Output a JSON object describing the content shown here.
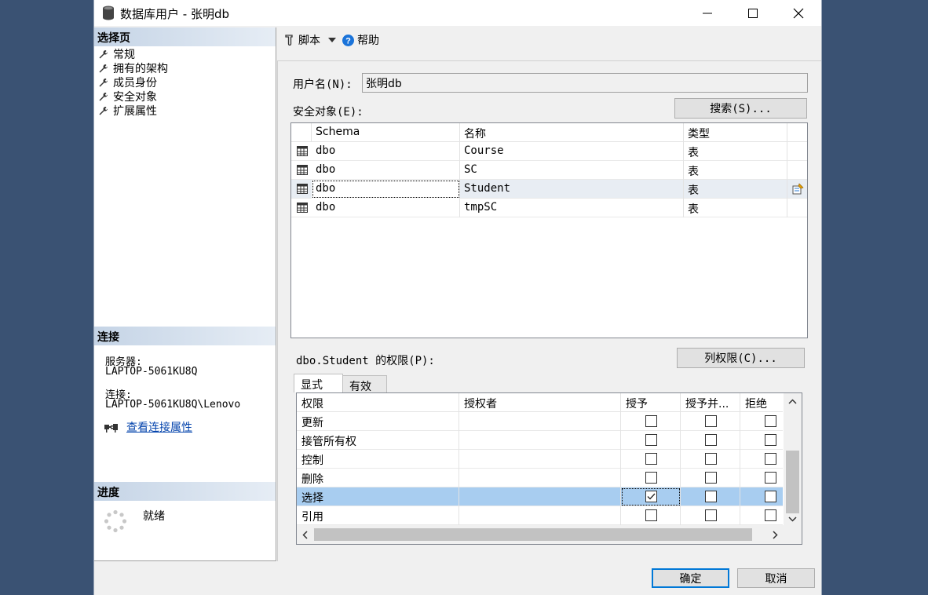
{
  "window": {
    "title": "数据库用户 - 张明db"
  },
  "left": {
    "select_page_header": "选择页",
    "pages": [
      {
        "label": "常规",
        "icon": "wrench-icon"
      },
      {
        "label": "拥有的架构",
        "icon": "wrench-icon"
      },
      {
        "label": "成员身份",
        "icon": "wrench-icon"
      },
      {
        "label": "安全对象",
        "icon": "wrench-icon"
      },
      {
        "label": "扩展属性",
        "icon": "wrench-icon"
      }
    ],
    "connection_header": "连接",
    "server_label": "服务器:",
    "server_value": "LAPTOP-5061KU8Q",
    "connection_label": "连接:",
    "connection_value": "LAPTOP-5061KU8Q\\Lenovo",
    "view_props_link": "查看连接属性",
    "progress_header": "进度",
    "progress_status": "就绪"
  },
  "toolbar": {
    "script_label": "脚本",
    "help_label": "帮助"
  },
  "form": {
    "username_label": "用户名(N):",
    "username_value": "张明db",
    "securables_label": "安全对象(E):",
    "search_button": "搜索(S)...",
    "permissions_label": "dbo.Student 的权限(P):",
    "column_perms_button": "列权限(C)..."
  },
  "securables": {
    "columns": [
      "Schema",
      "名称",
      "类型"
    ],
    "rows": [
      {
        "schema": "dbo",
        "name": "Course",
        "type": "表"
      },
      {
        "schema": "dbo",
        "name": "SC",
        "type": "表"
      },
      {
        "schema": "dbo",
        "name": "Student",
        "type": "表"
      },
      {
        "schema": "dbo",
        "name": "tmpSC",
        "type": "表"
      }
    ],
    "selected_row": 2
  },
  "tabs": {
    "explicit": "显式",
    "effective": "有效"
  },
  "permissions": {
    "columns": [
      "权限",
      "授权者",
      "授予",
      "授予并...",
      "拒绝"
    ],
    "rows": [
      {
        "perm": "更新",
        "grantor": "",
        "grant": false,
        "with_grant": false,
        "deny": false
      },
      {
        "perm": "接管所有权",
        "grantor": "",
        "grant": false,
        "with_grant": false,
        "deny": false
      },
      {
        "perm": "控制",
        "grantor": "",
        "grant": false,
        "with_grant": false,
        "deny": false
      },
      {
        "perm": "删除",
        "grantor": "",
        "grant": false,
        "with_grant": false,
        "deny": false
      },
      {
        "perm": "选择",
        "grantor": "",
        "grant": true,
        "with_grant": false,
        "deny": false
      },
      {
        "perm": "引用",
        "grantor": "",
        "grant": false,
        "with_grant": false,
        "deny": false
      }
    ],
    "selected_row": 4
  },
  "footer": {
    "ok_button": "确定",
    "cancel_button": "取消"
  }
}
